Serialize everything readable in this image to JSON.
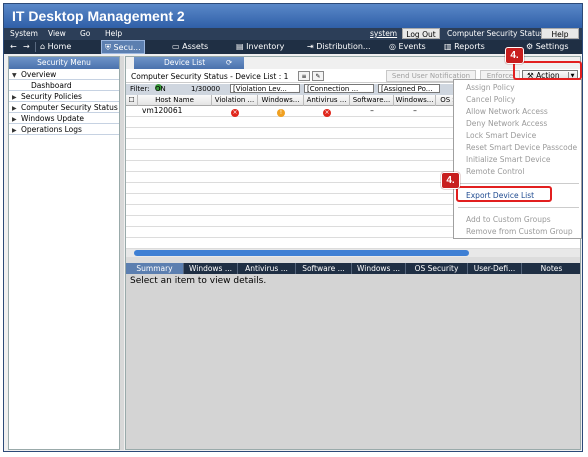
{
  "app": {
    "title": "IT Desktop Management 2"
  },
  "menubar": {
    "items": [
      "System",
      "View",
      "Go",
      "Help"
    ],
    "user": "system",
    "logout": "Log Out",
    "status": "Computer Security Status",
    "help": "Help"
  },
  "navbar": {
    "back": "←",
    "forward": "→",
    "items": [
      "Home",
      "Secu...",
      "Assets",
      "Inventory",
      "Distribution...",
      "Events",
      "Reports",
      "Settings"
    ],
    "active_index": 1
  },
  "left": {
    "header": "Security Menu",
    "tree": [
      {
        "label": "Overview",
        "expanded": true
      },
      {
        "label": "Dashboard",
        "child": true
      },
      {
        "label": "Security Policies",
        "expanded": false
      },
      {
        "label": "Computer Security Status",
        "expanded": false
      },
      {
        "label": "Windows Update",
        "expanded": false
      },
      {
        "label": "Operations Logs",
        "expanded": false
      }
    ]
  },
  "right": {
    "tab": "Device List",
    "toolbar_title": "Computer Security Status - Device List : 1",
    "send_notification": "Send User Notification",
    "enforce": "Enforce",
    "action": "Action"
  },
  "filter": {
    "label": "Filter:",
    "state": "ON",
    "count": "1/30000",
    "chips": [
      "[Violation Lev...",
      "[Connection ...",
      "[Assigned Po..."
    ]
  },
  "grid": {
    "columns": [
      "Host Name",
      "Violation ...",
      "Windows...",
      "Antivirus ...",
      "Software...",
      "Windows...",
      "OS S"
    ],
    "rows": [
      {
        "host": "vm120061",
        "violation": "red",
        "windows": "orange",
        "antivirus": "red",
        "software": "–",
        "windows2": "–"
      }
    ]
  },
  "detail_tabs": [
    "Summary",
    "Windows ...",
    "Antivirus ...",
    "Software ...",
    "Windows ...",
    "OS Security",
    "User-Defi...",
    "Notes"
  ],
  "details_msg": "Select an item to view details.",
  "action_menu": {
    "items": [
      {
        "label": "Assign Policy",
        "enabled": false
      },
      {
        "label": "Cancel Policy",
        "enabled": false
      },
      {
        "label": "Allow Network Access",
        "enabled": false
      },
      {
        "label": "Deny Network Access",
        "enabled": false
      },
      {
        "label": "Lock Smart Device",
        "enabled": false
      },
      {
        "label": "Reset Smart Device Passcode",
        "enabled": false
      },
      {
        "label": "Initialize Smart Device",
        "enabled": false
      },
      {
        "label": "Remote Control",
        "enabled": false
      },
      {
        "label": "Export Device List",
        "enabled": true
      },
      {
        "label": "Add to Custom Groups",
        "enabled": false
      },
      {
        "label": "Remove from Custom Group",
        "enabled": false
      }
    ]
  },
  "annotations": {
    "step1": "4.",
    "step2": "4."
  },
  "colors": {
    "highlight": "#e21f1f",
    "titlebar": "#2f5fa8",
    "navbar": "#1f2f44"
  }
}
